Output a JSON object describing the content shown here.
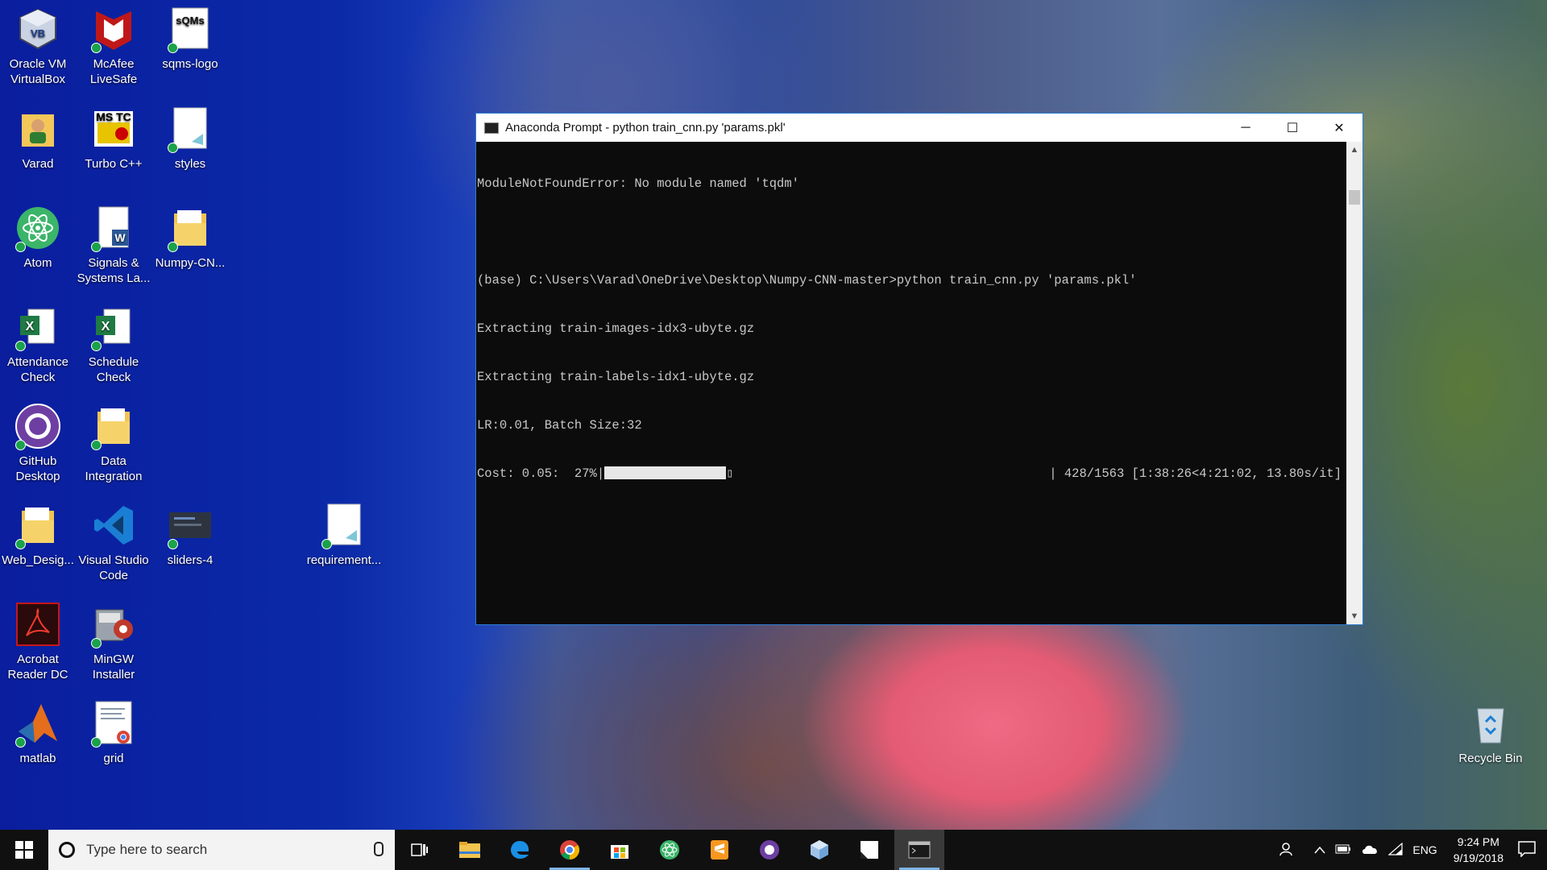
{
  "desktop": {
    "icons": [
      {
        "label1": "Oracle VM",
        "label2": "VirtualBox",
        "icon": "virtualbox-icon"
      },
      {
        "label1": "McAfee",
        "label2": "LiveSafe",
        "icon": "mcafee-icon"
      },
      {
        "label1": "sqms-logo",
        "label2": "",
        "icon": "sqms-logo-icon",
        "glyph": "sQMs"
      },
      {
        "label1": "Varad",
        "label2": "",
        "icon": "user-folder-icon"
      },
      {
        "label1": "Turbo C++",
        "label2": "",
        "icon": "turbo-cpp-icon",
        "glyph": "MS TC"
      },
      {
        "label1": "styles",
        "label2": "",
        "icon": "file-icon"
      },
      {
        "label1": "Atom",
        "label2": "",
        "icon": "atom-icon"
      },
      {
        "label1": "Signals &",
        "label2": "Systems La...",
        "icon": "word-document-icon",
        "glyph": "W"
      },
      {
        "label1": "Numpy-CN...",
        "label2": "",
        "icon": "folder-icon"
      },
      {
        "label1": "Attendance",
        "label2": "Check",
        "icon": "excel-icon",
        "glyph": "X"
      },
      {
        "label1": "Schedule",
        "label2": "Check",
        "icon": "excel-icon",
        "glyph": "X"
      },
      {
        "label1": "GitHub",
        "label2": "Desktop",
        "icon": "github-icon"
      },
      {
        "label1": "Data",
        "label2": "Integration",
        "icon": "folder-icon"
      },
      {
        "label1": "Web_Desig...",
        "label2": "",
        "icon": "folder-icon"
      },
      {
        "label1": "Visual Studio",
        "label2": "Code",
        "icon": "vscode-icon"
      },
      {
        "label1": "sliders-4",
        "label2": "",
        "icon": "image-thumbnail-icon"
      },
      {
        "label1": "requirement...",
        "label2": "",
        "icon": "file-icon"
      },
      {
        "label1": "Acrobat",
        "label2": "Reader DC",
        "icon": "acrobat-icon"
      },
      {
        "label1": "MinGW",
        "label2": "Installer",
        "icon": "mingw-icon"
      },
      {
        "label1": "matlab",
        "label2": "",
        "icon": "matlab-icon"
      },
      {
        "label1": "grid",
        "label2": "",
        "icon": "chrome-html-file-icon"
      },
      {
        "label1": "Recycle Bin",
        "label2": "",
        "icon": "recycle-bin-icon"
      }
    ]
  },
  "window": {
    "title": "Anaconda Prompt - python  train_cnn.py 'params.pkl'",
    "minimize": "─",
    "maximize": "☐",
    "close": "✕",
    "lines": [
      "ModuleNotFoundError: No module named 'tqdm'",
      "",
      "(base) C:\\Users\\Varad\\OneDrive\\Desktop\\Numpy-CNN-master>python train_cnn.py 'params.pkl'",
      "Extracting train-images-idx3-ubyte.gz",
      "Extracting train-labels-idx1-ubyte.gz",
      "LR:0.01, Batch Size:32"
    ],
    "progress_prefix": "Cost: 0.05:  27%|",
    "progress_fraction": 0.27,
    "progress_tail": "▯",
    "progress_suffix": "| 428/1563 [1:38:26<4:21:02, 13.80s/it]",
    "scroll_up": "▲",
    "scroll_down": "▼"
  },
  "taskbar": {
    "search_placeholder": "Type here to search",
    "language": "ENG",
    "time": "9:24 PM",
    "date": "9/19/2018",
    "accent": "#7fb4e6"
  }
}
